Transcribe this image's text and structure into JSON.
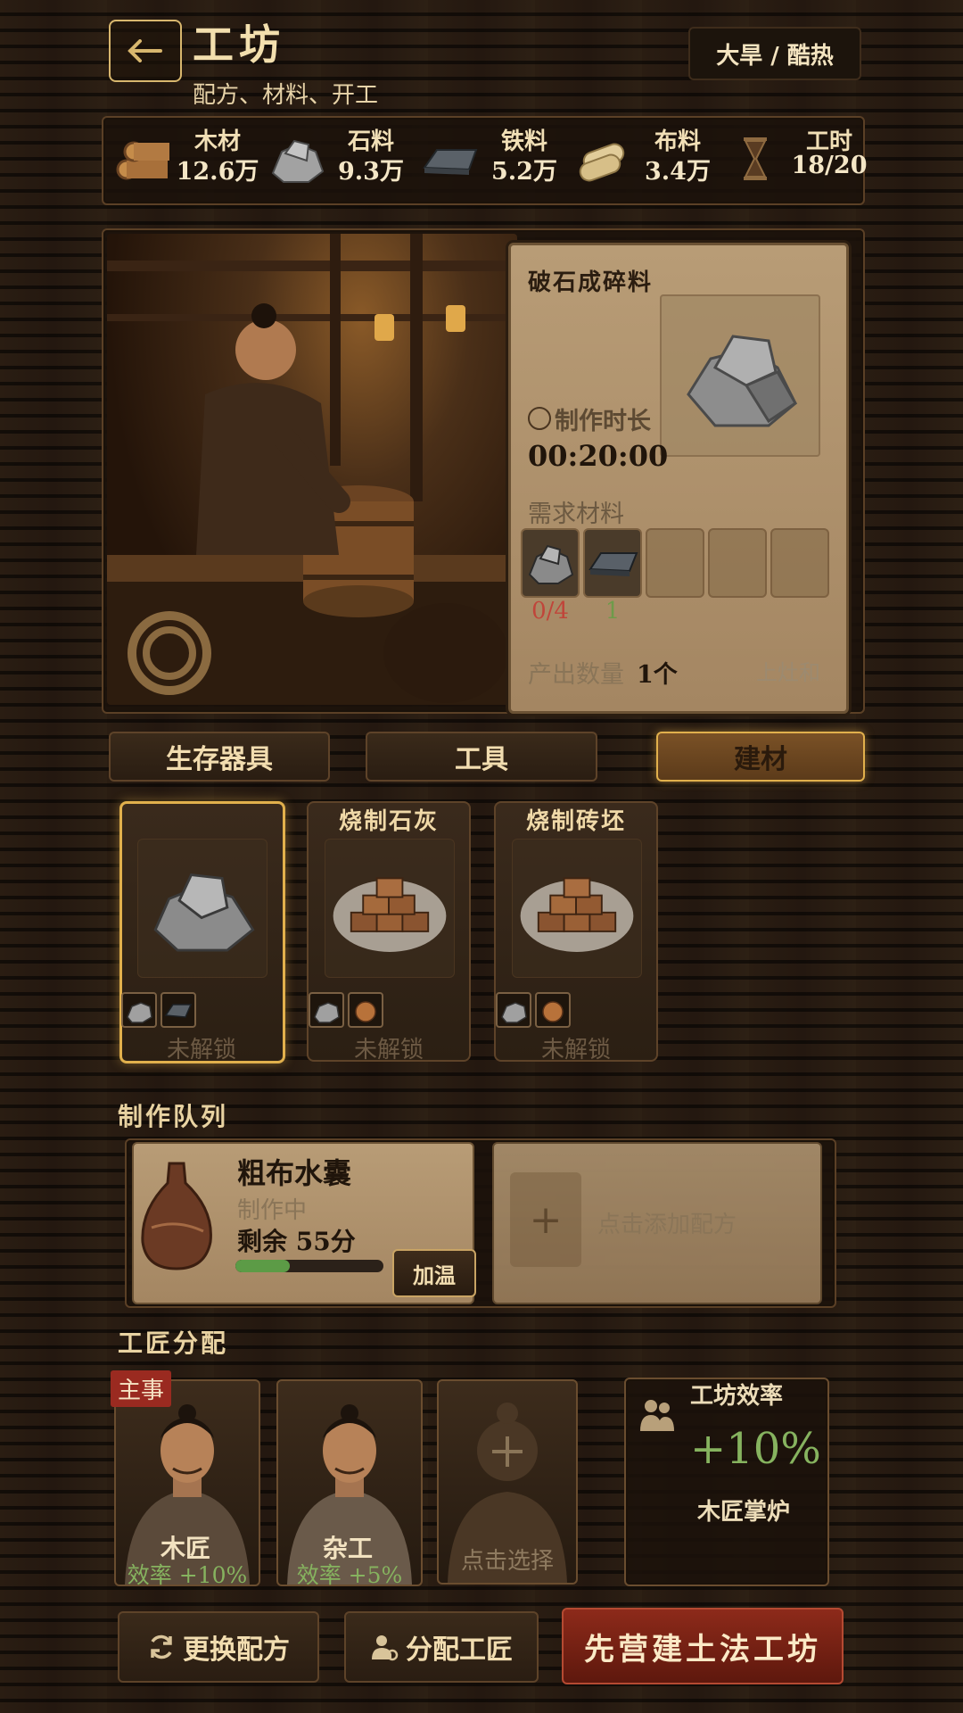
{
  "header": {
    "title": "工坊",
    "subtitle": "配方、材料、开工",
    "weather": "大旱 / 酷热",
    "back_icon": "back-arrow-icon"
  },
  "resources": [
    {
      "name": "木材",
      "value": "12.6万",
      "icon": "wood-logs-icon"
    },
    {
      "name": "石料",
      "value": "9.3万",
      "icon": "stone-icon"
    },
    {
      "name": "铁料",
      "value": "5.2万",
      "icon": "iron-ingot-icon"
    },
    {
      "name": "布料",
      "value": "3.4万",
      "icon": "cloth-roll-icon"
    },
    {
      "name": "工时",
      "value": "18/20",
      "icon": "hourglass-icon"
    }
  ],
  "recipe_detail": {
    "name": "破石成碎料",
    "craft_time_label": "制作时长",
    "craft_time": "00:20:00",
    "materials_label": "需求材料",
    "materials": [
      {
        "icon": "stone-icon",
        "count": "0/4",
        "color": "#c0453a"
      },
      {
        "icon": "iron-ingot-icon",
        "count": "1",
        "color": "#6e9b4a"
      }
    ],
    "output_label": "产出数量",
    "output_value": "1个",
    "action_text": "上灶和"
  },
  "tabs": [
    {
      "label": "生存器具",
      "active": false
    },
    {
      "label": "工具",
      "active": false
    },
    {
      "label": "建材",
      "active": true
    }
  ],
  "recipes": [
    {
      "title": "",
      "status": "未解锁",
      "image": "stone-pile",
      "selected": true
    },
    {
      "title": "烧制石灰",
      "status": "未解锁",
      "image": "brick-pile",
      "selected": false
    },
    {
      "title": "烧制砖坯",
      "status": "未解锁",
      "image": "brick-pile",
      "selected": false
    }
  ],
  "queue": {
    "label": "制作队列",
    "item": {
      "name": "粗布水囊",
      "status": "制作中",
      "remaining": "剩余 55分",
      "progress": 0.37,
      "button": "加温"
    },
    "empty_slot": "点击添加配方"
  },
  "workers": {
    "label": "工匠分配",
    "list": [
      {
        "role": "木匠",
        "efficiency": "效率 +10%",
        "badge": "主事"
      },
      {
        "role": "杂工",
        "efficiency": "效率 +5%",
        "badge": ""
      }
    ],
    "empty_slot": "点击选择",
    "efficiency_panel": {
      "title": "工坊效率",
      "value": "+10%",
      "note": "木匠掌炉"
    }
  },
  "actions": {
    "change_recipe": "更换配方",
    "assign_worker": "分配工匠",
    "build": "先营建土法工坊"
  },
  "colors": {
    "accent": "#e1b04c",
    "danger": "#7a1f14",
    "positive": "#7aa85a"
  }
}
